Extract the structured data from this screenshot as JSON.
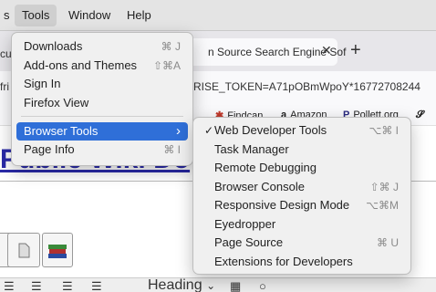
{
  "menubar": {
    "items": [
      "s",
      "Tools",
      "Window",
      "Help"
    ]
  },
  "browser": {
    "tab_left_fragment": "cu",
    "tab_title": "n Source Search Engine Sof",
    "close_glyph": "✕",
    "new_tab_glyph": "+",
    "url_left_fragment": "fri",
    "url_text": "RISE_TOKEN=A71pOBmWpoY*16772708244",
    "bookmarks": [
      {
        "icon": "✱",
        "label": "Findcan"
      },
      {
        "icon": "a",
        "label": "Amazon"
      },
      {
        "icon": "P",
        "label": "Pollett.org"
      },
      {
        "icon": "𝓢",
        "label": ""
      }
    ],
    "page_heading": "Public Wiki Do"
  },
  "tools_menu": {
    "items": [
      {
        "label": "Downloads",
        "shortcut": "⌘ J"
      },
      {
        "label": "Add-ons and Themes",
        "shortcut": "⇧⌘A"
      },
      {
        "label": "Sign In",
        "shortcut": ""
      },
      {
        "label": "Firefox View",
        "shortcut": ""
      },
      {
        "label": "Browser Tools",
        "shortcut": "›"
      },
      {
        "label": "Page Info",
        "shortcut": "⌘ I"
      }
    ],
    "highlighted": "Browser Tools"
  },
  "browser_tools_submenu": {
    "items": [
      {
        "label": "Web Developer Tools",
        "shortcut": "⌥⌘ I",
        "checked": true
      },
      {
        "label": "Task Manager",
        "shortcut": ""
      },
      {
        "label": "Remote Debugging",
        "shortcut": ""
      },
      {
        "label": "Browser Console",
        "shortcut": "⇧⌘ J"
      },
      {
        "label": "Responsive Design Mode",
        "shortcut": "⌥⌘M"
      },
      {
        "label": "Eyedropper",
        "shortcut": ""
      },
      {
        "label": "Page Source",
        "shortcut": "⌘ U"
      },
      {
        "label": "Extensions for Developers",
        "shortcut": ""
      }
    ],
    "check_glyph": "✓"
  },
  "editor": {
    "heading_select": "Heading",
    "heading_select_caret": "⌄"
  },
  "colors": {
    "highlight": "#2f6fd8",
    "menu_bg": "#f0f0f0",
    "link_heading": "#2a2aa8"
  }
}
